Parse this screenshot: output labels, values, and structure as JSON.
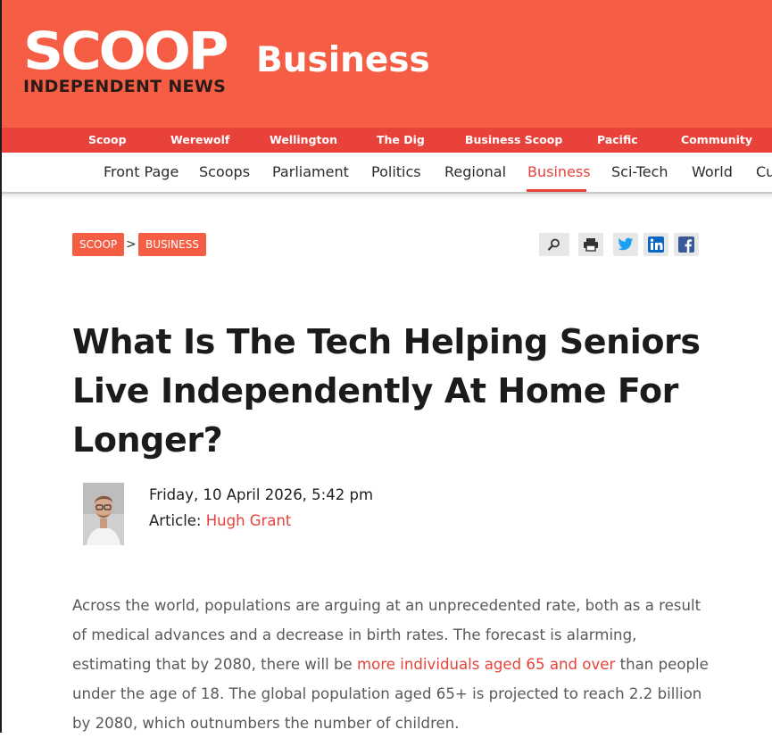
{
  "header": {
    "logo_word": "SCOOP",
    "logo_sub": "INDEPENDENT NEWS",
    "section_title": "Business",
    "colors": {
      "header_bg": "#f55e44",
      "netbar_bg": "#e8423b",
      "accent": "#e8423b"
    }
  },
  "network_nav": [
    "Scoop",
    "Werewolf",
    "Wellington",
    "The Dig",
    "Business Scoop",
    "Pacific",
    "Community"
  ],
  "section_nav": {
    "items": [
      "Front Page",
      "Scoops",
      "Parliament",
      "Politics",
      "Regional",
      "Business",
      "Sci-Tech",
      "World",
      "Cu"
    ],
    "active": "Business"
  },
  "breadcrumb": {
    "root": "SCOOP",
    "separator": ">",
    "current": "BUSINESS"
  },
  "share_icons": [
    "search-icon",
    "print-icon",
    "twitter-icon",
    "linkedin-icon",
    "facebook-icon"
  ],
  "article": {
    "title": "What Is The Tech Helping Seniors Live Independently At Home For Longer?",
    "date": "Friday, 10 April 2026, 5:42 pm",
    "author_label": "Article:",
    "author_name": "Hugh Grant",
    "body_before_link": "Across the world, populations are arguing at an unprecedented rate, both as a result of medical advances and a decrease in birth rates. The forecast is alarming, estimating that by 2080, there will be ",
    "body_link": "more individuals aged 65 and over",
    "body_after_link": " than people under the age of 18. The global population aged 65+ is projected to reach 2.2 billion by 2080, which outnumbers the number of children."
  }
}
